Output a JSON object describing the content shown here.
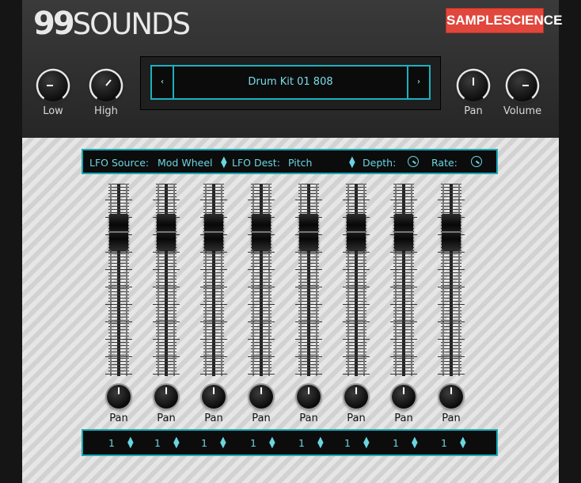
{
  "brand": {
    "logo_num": "99",
    "logo_word": "SOUNDS",
    "partner": "SAMPLESCIENCE"
  },
  "controls": {
    "low_label": "Low",
    "high_label": "High",
    "pan_label": "Pan",
    "volume_label": "Volume"
  },
  "preset": {
    "name": "Drum Kit 01 808",
    "prev": "‹",
    "next": "›"
  },
  "lfo": {
    "source_label": "LFO Source:",
    "source_value": "Mod Wheel",
    "dest_label": "LFO Dest:",
    "dest_value": "Pitch",
    "depth_label": "Depth:",
    "rate_label": "Rate:"
  },
  "channels": [
    {
      "pan_label": "Pan",
      "value": "1"
    },
    {
      "pan_label": "Pan",
      "value": "1"
    },
    {
      "pan_label": "Pan",
      "value": "1"
    },
    {
      "pan_label": "Pan",
      "value": "1"
    },
    {
      "pan_label": "Pan",
      "value": "1"
    },
    {
      "pan_label": "Pan",
      "value": "1"
    },
    {
      "pan_label": "Pan",
      "value": "1"
    },
    {
      "pan_label": "Pan",
      "value": "1"
    }
  ],
  "accent_color": "#1ab1c0",
  "stepper_icon": "up-down-arrows-icon"
}
